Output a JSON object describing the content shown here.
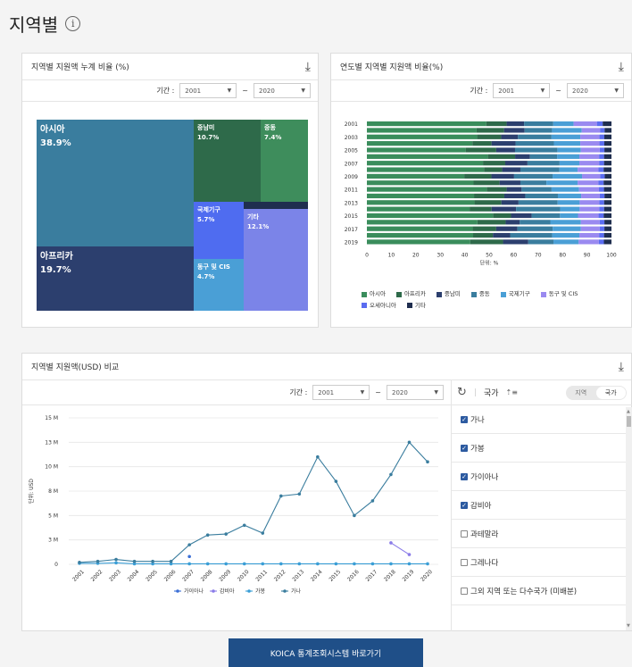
{
  "page": {
    "title": "지역별",
    "info_glyph": "i"
  },
  "common": {
    "period_label": "기간 :",
    "tilde": "~",
    "download_glyph": "⤓"
  },
  "panel_treemap": {
    "title": "지역별 지원액 누계 비율 (%)",
    "start": "2001",
    "end": "2020",
    "cells": [
      {
        "name": "아시아",
        "pct": "38.9%",
        "color": "#3a7d9e"
      },
      {
        "name": "아프리카",
        "pct": "19.7%",
        "color": "#2c3f6e"
      },
      {
        "name": "중남미",
        "pct": "10.7%",
        "color": "#2e6a4a"
      },
      {
        "name": "중동",
        "pct": "7.4%",
        "color": "#3e8d5c"
      },
      {
        "name": "국제기구",
        "pct": "5.7%",
        "color": "#4f6cf0"
      },
      {
        "name": "동구 및 CIS",
        "pct": "4.7%",
        "color": "#4a9fd6"
      },
      {
        "name": "기타",
        "pct": "12.1%",
        "color": "#7b84e8"
      },
      {
        "name": "",
        "pct": "",
        "color": "#1f2e4f"
      }
    ]
  },
  "panel_stacked": {
    "title": "연도별 지역별 지원액 비율(%)",
    "start": "2001",
    "end": "2020",
    "xlabel": "단위: %",
    "xticks": [
      "0",
      "10",
      "20",
      "30",
      "40",
      "50",
      "60",
      "70",
      "80",
      "90",
      "100"
    ],
    "yticks": [
      "2001",
      "2003",
      "2005",
      "2007",
      "2009",
      "2011",
      "2013",
      "2015",
      "2017",
      "2019"
    ],
    "legend": [
      {
        "name": "아시아",
        "color": "#3a8d5c"
      },
      {
        "name": "아프리카",
        "color": "#2e6a4a"
      },
      {
        "name": "중남미",
        "color": "#2c3f6e"
      },
      {
        "name": "중동",
        "color": "#3a7d9e"
      },
      {
        "name": "국제기구",
        "color": "#4a9fd6"
      },
      {
        "name": "동구 및 CIS",
        "color": "#9a8af0"
      },
      {
        "name": "오세아니아",
        "color": "#5a6cf0"
      },
      {
        "name": "기타",
        "color": "#1f2e4f"
      }
    ]
  },
  "panel_compare": {
    "title": "지역별 지원액(USD) 비교",
    "start": "2001",
    "end": "2020",
    "side_label": "국가",
    "sort_glyph": "⇡≡",
    "refresh_glyph": "↻",
    "toggle": {
      "left": "지역",
      "right": "국가"
    },
    "countries": [
      {
        "name": "가나",
        "checked": true
      },
      {
        "name": "가봉",
        "checked": true
      },
      {
        "name": "가이아나",
        "checked": true
      },
      {
        "name": "감비아",
        "checked": true
      },
      {
        "name": "과테말라",
        "checked": false
      },
      {
        "name": "그레나다",
        "checked": false
      },
      {
        "name": "그외 지역 또는 다수국가 (미배분)",
        "checked": false
      }
    ]
  },
  "chart_data": {
    "type": "line",
    "title": "",
    "ylabel": "단위: USD",
    "yticks": [
      "0",
      "3 M",
      "5 M",
      "8 M",
      "10 M",
      "13 M",
      "15 M"
    ],
    "ylim": [
      0,
      15000000
    ],
    "x": [
      "2001",
      "2002",
      "2003",
      "2004",
      "2005",
      "2006",
      "2007",
      "2008",
      "2009",
      "2010",
      "2011",
      "2012",
      "2013",
      "2014",
      "2015",
      "2016",
      "2017",
      "2018",
      "2019",
      "2020"
    ],
    "series": [
      {
        "name": "가이아나",
        "color": "#3b6fd6",
        "values": [
          null,
          null,
          null,
          null,
          null,
          null,
          800000,
          null,
          null,
          null,
          null,
          null,
          null,
          null,
          null,
          null,
          null,
          null,
          null,
          null
        ]
      },
      {
        "name": "감비아",
        "color": "#8a7be8",
        "values": [
          null,
          null,
          null,
          null,
          null,
          null,
          null,
          null,
          null,
          null,
          null,
          null,
          null,
          null,
          null,
          null,
          null,
          2200000,
          1000000,
          null
        ]
      },
      {
        "name": "가봉",
        "color": "#3a9ed6",
        "values": [
          100000,
          100000,
          150000,
          50000,
          50000,
          50000,
          50000,
          50000,
          50000,
          50000,
          50000,
          50000,
          50000,
          50000,
          50000,
          50000,
          50000,
          50000,
          50000,
          50000
        ]
      },
      {
        "name": "가나",
        "color": "#3a7d9e",
        "values": [
          200000,
          300000,
          500000,
          300000,
          300000,
          300000,
          2000000,
          3000000,
          3100000,
          4000000,
          3200000,
          7000000,
          7200000,
          11000000,
          8500000,
          5000000,
          6500000,
          9200000,
          12500000,
          10500000
        ]
      }
    ]
  },
  "footer": {
    "koica_button": "KOICA 통계조회시스템 바로가기"
  }
}
